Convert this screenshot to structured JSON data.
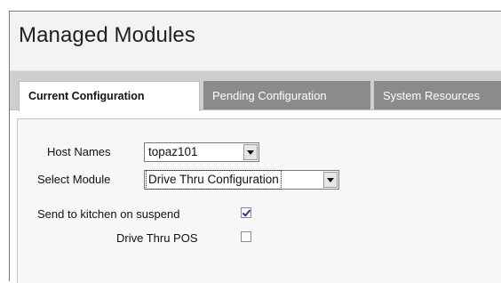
{
  "page": {
    "title": "Managed Modules"
  },
  "tabs": [
    {
      "label": "Current Configuration",
      "active": true
    },
    {
      "label": "Pending Configuration",
      "active": false
    },
    {
      "label": "System Resources",
      "active": false
    }
  ],
  "form": {
    "host_names": {
      "label": "Host Names",
      "value": "topaz101"
    },
    "select_module": {
      "label": "Select Module",
      "value": "Drive Thru Configuration"
    },
    "send_to_kitchen": {
      "label": "Send to kitchen on suspend",
      "checked": true
    },
    "drive_thru_pos": {
      "label": "Drive Thru POS",
      "checked": false
    }
  },
  "colors": {
    "tabbar_bg": "#cfcfcf",
    "inactive_tab_bg": "#8b8b8b",
    "checkmark": "#2a3d8f"
  }
}
